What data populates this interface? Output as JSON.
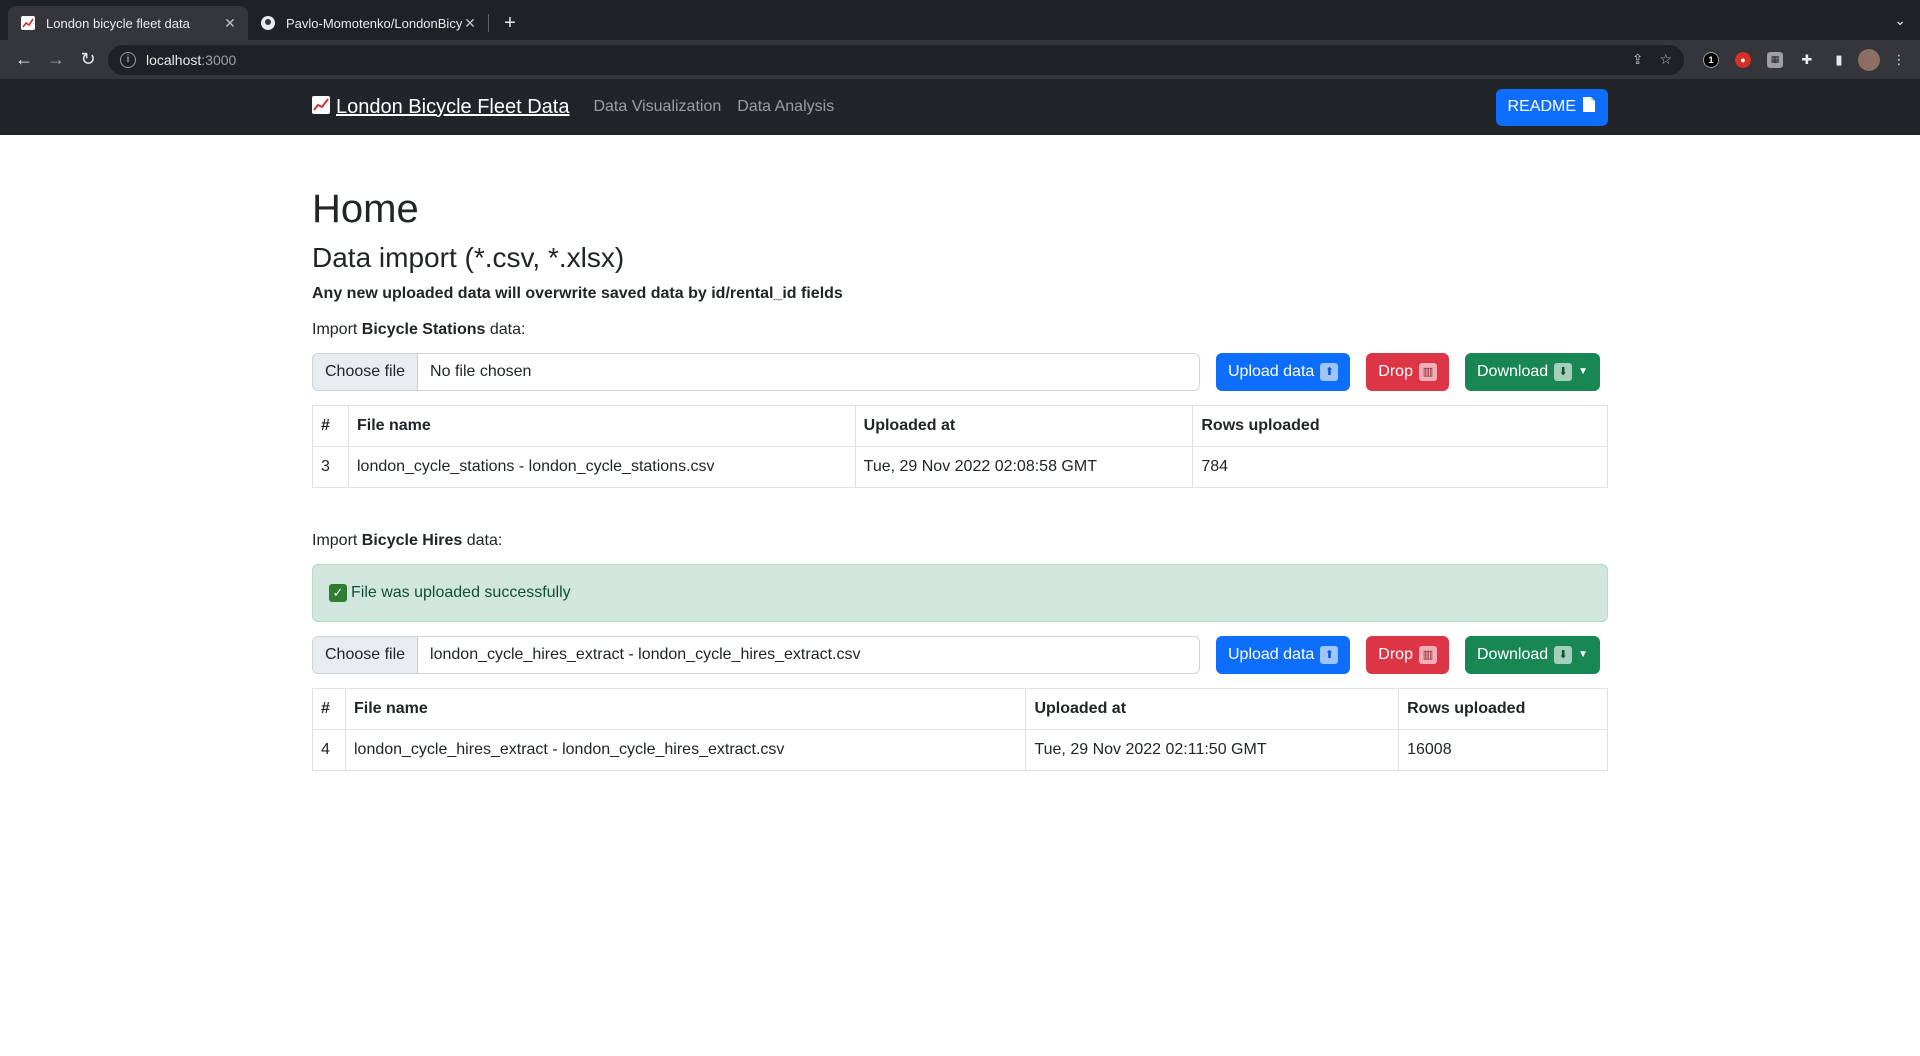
{
  "browser": {
    "tabs": [
      {
        "title": "London bicycle fleet data",
        "favicon": "chart-icon"
      },
      {
        "title": "Pavlo-Momotenko/LondonBicy",
        "favicon": "github-icon"
      }
    ],
    "url_host": "localhost",
    "url_port": ":3000"
  },
  "navbar": {
    "brand": "London Bicycle Fleet Data",
    "links": [
      "Data Visualization",
      "Data Analysis"
    ],
    "readme": "README"
  },
  "page": {
    "title": "Home",
    "subtitle": "Data import (*.csv, *.xlsx)",
    "note": "Any new uploaded data will overwrite saved data by id/rental_id fields"
  },
  "stations": {
    "label_prefix": "Import ",
    "label_bold": "Bicycle Stations",
    "label_suffix": " data:",
    "choose_label": "Choose file",
    "file_name": "No file chosen",
    "upload_label": "Upload data",
    "drop_label": "Drop",
    "download_label": "Download",
    "headers": [
      "#",
      "File name",
      "Uploaded at",
      "Rows uploaded"
    ],
    "rows": [
      [
        "3",
        "london_cycle_stations - london_cycle_stations.csv",
        "Tue, 29 Nov 2022 02:08:58 GMT",
        "784"
      ]
    ]
  },
  "hires": {
    "label_prefix": "Import ",
    "label_bold": "Bicycle Hires",
    "label_suffix": " data:",
    "alert": "File was uploaded successfully",
    "choose_label": "Choose file",
    "file_name": "london_cycle_hires_extract - london_cycle_hires_extract.csv",
    "upload_label": "Upload data",
    "drop_label": "Drop",
    "download_label": "Download",
    "headers": [
      "#",
      "File name",
      "Uploaded at",
      "Rows uploaded"
    ],
    "rows": [
      [
        "4",
        "london_cycle_hires_extract - london_cycle_hires_extract.csv",
        "Tue, 29 Nov 2022 02:11:50 GMT",
        "16008"
      ]
    ]
  },
  "colors": {
    "primary": "#0d6efd",
    "danger": "#dc3545",
    "success": "#198754",
    "navbar_bg": "#212529",
    "alert_bg": "#d1e7dd"
  }
}
